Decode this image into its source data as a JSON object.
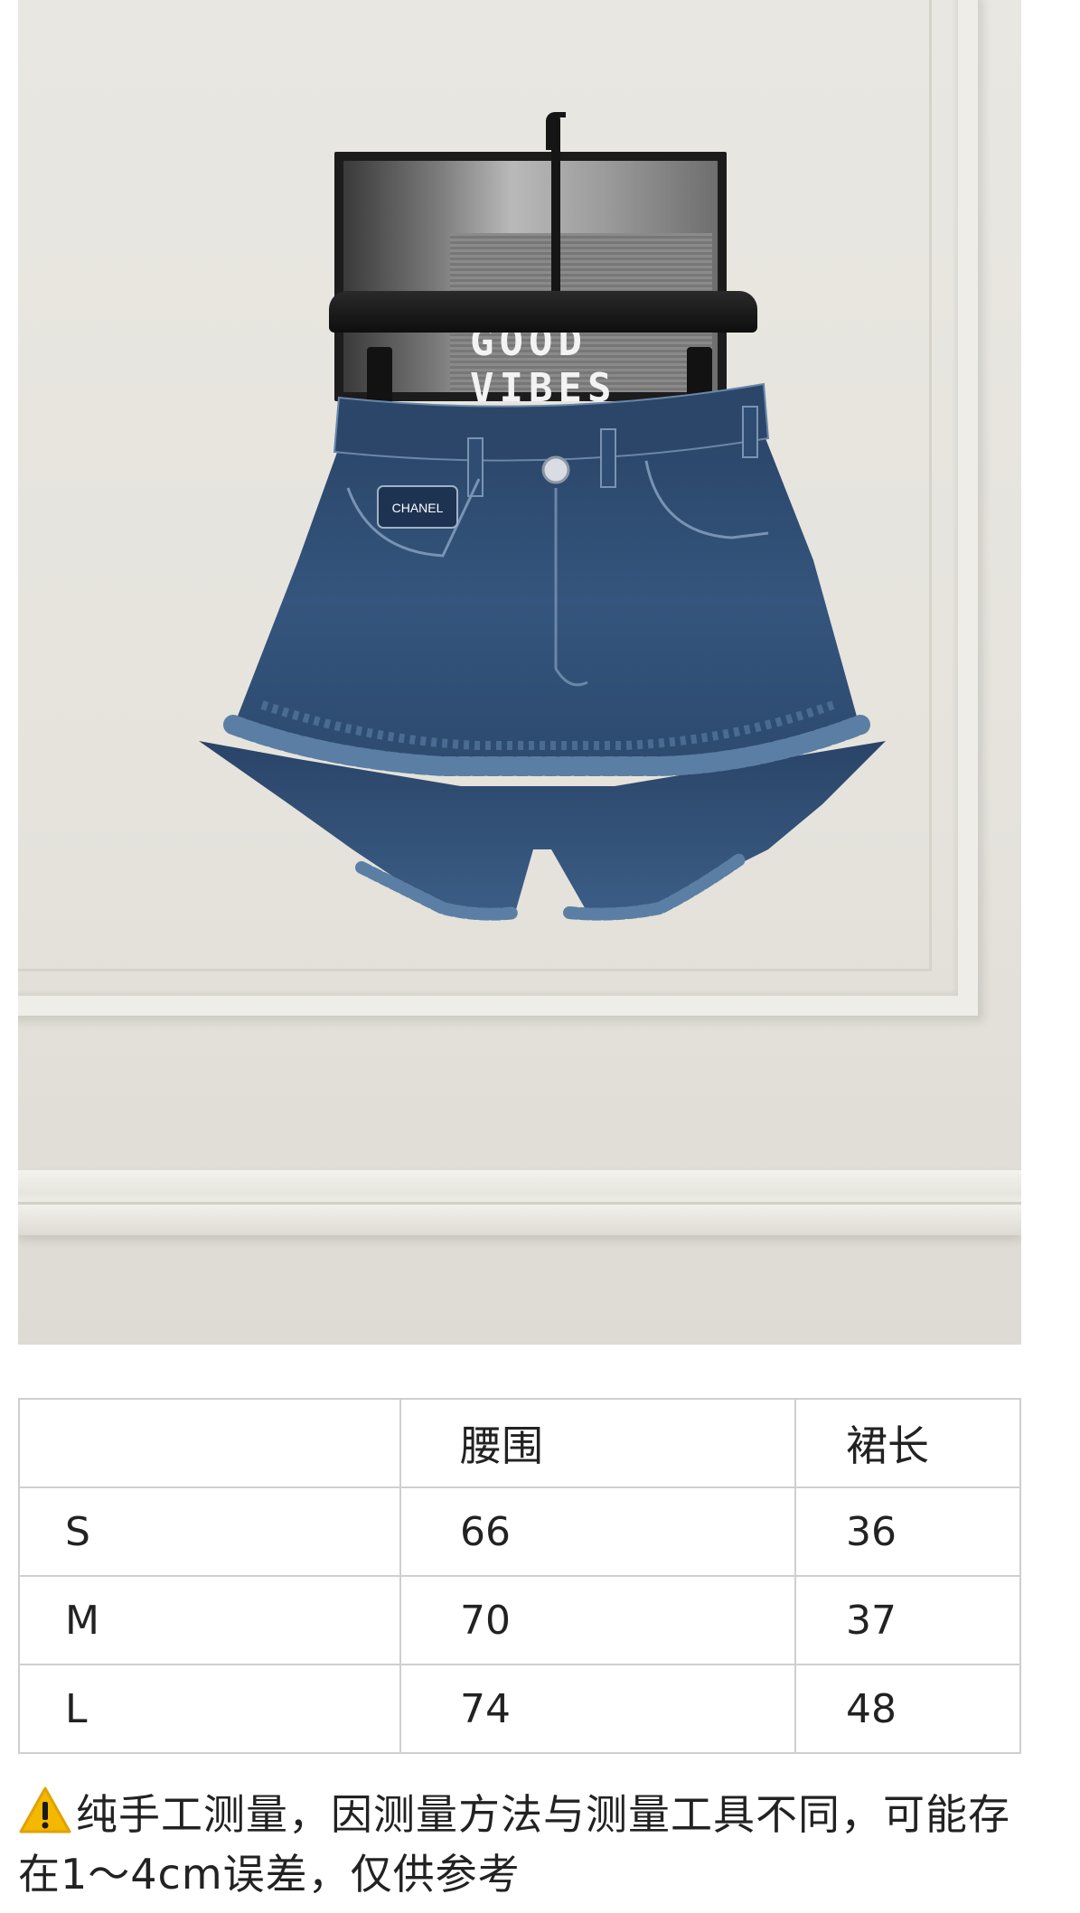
{
  "photo": {
    "wall_sign_text": "GOOD VIBES",
    "brand_patch_text": "CHANEL",
    "colors": {
      "wall": "#e7e5df",
      "denim": "#2f4d72",
      "hanger": "#151515"
    }
  },
  "size_table": {
    "headers": [
      "",
      "腰围",
      "裙长"
    ],
    "rows": [
      [
        "S",
        "66",
        "36"
      ],
      [
        "M",
        "70",
        "37"
      ],
      [
        "L",
        "74",
        "48"
      ]
    ]
  },
  "note": {
    "icon": "warning-icon",
    "text": "纯手工测量，因测量方法与测量工具不同，可能存在1～4cm误差，仅供参考"
  }
}
